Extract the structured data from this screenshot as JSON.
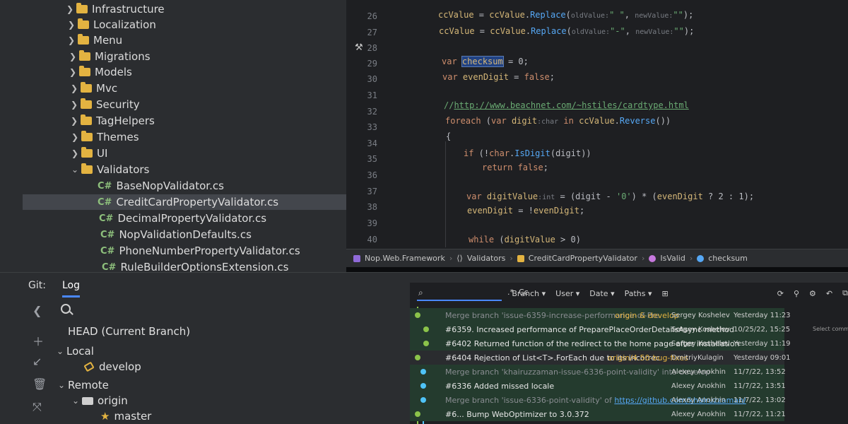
{
  "project_tree": {
    "items": [
      {
        "label": "Infrastructure",
        "type": "folder",
        "expanded": false
      },
      {
        "label": "Localization",
        "type": "folder",
        "expanded": false
      },
      {
        "label": "Menu",
        "type": "folder",
        "expanded": false
      },
      {
        "label": "Migrations",
        "type": "folder",
        "expanded": false
      },
      {
        "label": "Models",
        "type": "folder",
        "expanded": false
      },
      {
        "label": "Mvc",
        "type": "folder",
        "expanded": false
      },
      {
        "label": "Security",
        "type": "folder",
        "expanded": false
      },
      {
        "label": "TagHelpers",
        "type": "folder",
        "expanded": false
      },
      {
        "label": "Themes",
        "type": "folder",
        "expanded": false
      },
      {
        "label": "UI",
        "type": "folder",
        "expanded": false
      },
      {
        "label": "Validators",
        "type": "folder",
        "expanded": true
      },
      {
        "label": "BaseNopValidator.cs",
        "type": "file"
      },
      {
        "label": "CreditCardPropertyValidator.cs",
        "type": "file",
        "selected": true
      },
      {
        "label": "DecimalPropertyValidator.cs",
        "type": "file"
      },
      {
        "label": "NopValidationDefaults.cs",
        "type": "file"
      },
      {
        "label": "PhoneNumberPropertyValidator.cs",
        "type": "file"
      },
      {
        "label": "RuleBuilderOptionsExtension.cs",
        "type": "file"
      }
    ],
    "file_badge": "C#"
  },
  "editor": {
    "line_numbers": [
      "26",
      "27",
      "28",
      "29",
      "30",
      "31",
      "32",
      "33",
      "34",
      "35",
      "36",
      "37",
      "38",
      "39",
      "40"
    ],
    "lines": {
      "l26": {
        "a": "ccValue",
        "b": " = ",
        "c": "ccValue",
        "d": ".",
        "e": "Replace",
        "f": "(",
        "g": "oldValue:",
        "h": "\" \"",
        "i": ", ",
        "j": "newValue:",
        "k": "\"\"",
        "l": ");"
      },
      "l27": {
        "a": "ccValue",
        "b": " = ",
        "c": "ccValue",
        "d": ".",
        "e": "Replace",
        "f": "(",
        "g": "oldValue:",
        "h": "\"-\"",
        "i": ", ",
        "j": "newValue:",
        "k": "\"\"",
        "l": ");"
      },
      "l28": {
        "kw": "var",
        "name": "checksum",
        "rest": " = 0;"
      },
      "l29": {
        "kw": "var",
        "name": "evenDigit",
        "rest": " = ",
        "val": "false",
        "end": ";"
      },
      "l31": {
        "prefix": "//",
        "url": "http://www.beachnet.com/~hstiles/cardtype.html"
      },
      "l32": {
        "kw": "foreach",
        "open": " (",
        "kw2": "var",
        "name": " digit",
        "hint": ":char",
        "kw3": " in ",
        "obj": "ccValue",
        "dot": ".",
        "m": "Reverse",
        "close": "())"
      },
      "l33": {
        "text": "{"
      },
      "l34": {
        "kw": "if",
        "rest1": " (!",
        "kw2": "char",
        "dot": ".",
        "m": "IsDigit",
        "rest2": "(digit))"
      },
      "l35": {
        "kw": "return",
        "val": " false",
        "end": ";"
      },
      "l37": {
        "kw": "var",
        "name": " digitValue",
        "hint": ":int",
        "rest": " = (digit - ",
        "ch": "'0'",
        "rest2": ") * (",
        "v": "evenDigit",
        "rest3": " ? 2 : 1);"
      },
      "l38": {
        "name": "evenDigit",
        "rest": " = !",
        "v": "evenDigit",
        "end": ";"
      },
      "l40": {
        "kw": "while",
        "rest": " (",
        "v": "digitValue",
        "end": " > 0)"
      }
    }
  },
  "breadcrumb": {
    "items": [
      "Nop.Web.Framework",
      "Validators",
      "CreditCardPropertyValidator",
      "IsValid",
      "checksum"
    ],
    "separator": "›"
  },
  "git": {
    "window_title": "Git:",
    "tab": "Log",
    "branches": {
      "head": "HEAD (Current Branch)",
      "local_label": "Local",
      "local_branch": "develop",
      "remote_label": "Remote",
      "remote_name": "origin",
      "remote_branch": "master"
    },
    "toolbar": {
      "case_label": "Cc",
      "regex_label": ".*",
      "filters": [
        "Branch",
        "User",
        "Date",
        "Paths"
      ]
    },
    "commits": [
      {
        "message": "Merge branch 'issue-6359-increase-performance-of-Pre",
        "ref": "origin & develop",
        "author": "Sergey Koshelev",
        "date": "Yesterday 11:23",
        "dim": true
      },
      {
        "message": "#6359. Increased performance of PreparePlaceOrderDetailsAsync method",
        "ref": "",
        "author": "Sergey Koshelev",
        "date": "10/25/22, 15:25",
        "dim": false
      },
      {
        "message": "#6402 Returned function of the redirect to the home page after installation",
        "ref": "",
        "author": "Sergey Koshelev",
        "date": "Yesterday 11:19",
        "dim": false
      },
      {
        "message": "#6404 Rejection of List<T>.ForEach due to its incorrec",
        "ref": "origin/4.50-bug-fixes",
        "author": "DmitriyKulagin",
        "date": "Yesterday 09:01",
        "dim": false
      },
      {
        "message": "Merge branch 'khairuzzaman-issue-6336-point-validity' into develop",
        "ref": "",
        "author": "Alexey Anokhin",
        "date": "11/7/22, 13:52",
        "dim": true
      },
      {
        "message": "#6336 Added missed locale",
        "ref": "",
        "author": "Alexey Anokhin",
        "date": "11/7/22, 13:51",
        "dim": false
      },
      {
        "message": "Merge branch 'issue-6336-point-validity' of ",
        "link": "https://github.com/khairuzzaman/",
        "ref": "",
        "author": "Alexey Anokhin",
        "date": "11/7/22, 13:02",
        "dim": true
      },
      {
        "message": "#6... Bump WebOptimizer to 3.0.372",
        "ref": "",
        "author": "Alexey Anokhin",
        "date": "11/7/22, 11:21",
        "dim": false
      }
    ],
    "right_note": "Select commit to",
    "colors": {
      "lane_green": "#8bc34a",
      "lane_blue": "#4fc3f7",
      "accent": "#4a88ff"
    }
  }
}
